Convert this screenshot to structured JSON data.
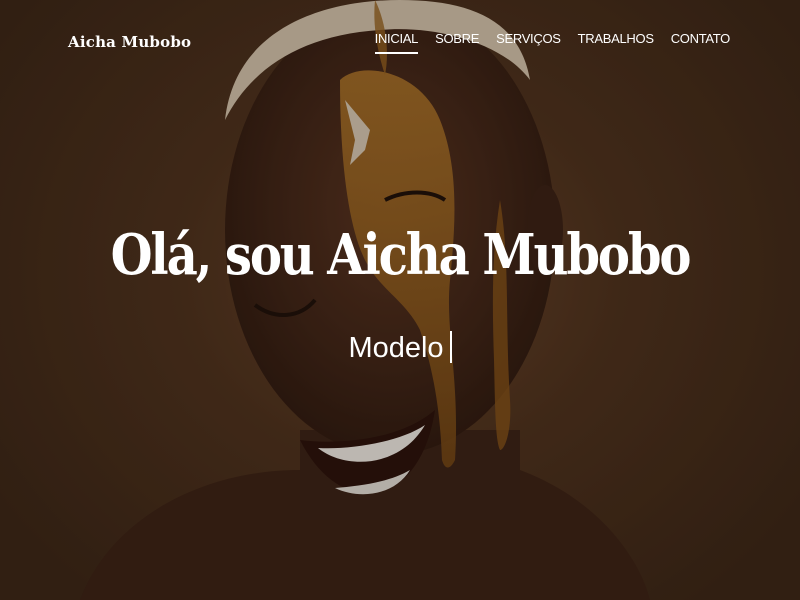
{
  "header": {
    "brand": "Aicha Mubobo",
    "nav": [
      {
        "label": "INICIAL",
        "active": true
      },
      {
        "label": "SOBRE",
        "active": false
      },
      {
        "label": "SERVIÇOS",
        "active": false
      },
      {
        "label": "TRABALHOS",
        "active": false
      },
      {
        "label": "CONTATO",
        "active": false
      }
    ]
  },
  "hero": {
    "title": "Olá, sou Aicha Mubobo",
    "subtitle": "Modelo",
    "background": "portrait-photo",
    "colors": {
      "background_base": "#4e321d",
      "text": "#ffffff"
    }
  }
}
